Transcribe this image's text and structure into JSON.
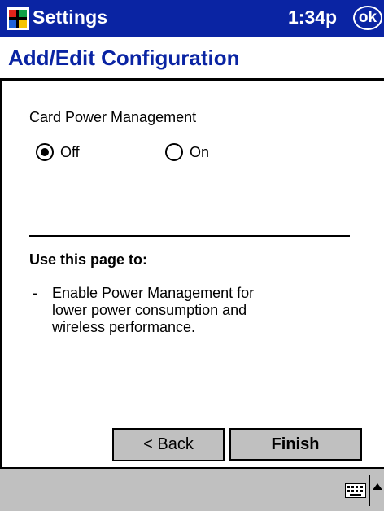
{
  "titlebar": {
    "app_title": "Settings",
    "time": "1:34p",
    "ok_label": "ok",
    "start_icon": "windows-flag-icon"
  },
  "page": {
    "title": "Add/Edit Configuration"
  },
  "power_management": {
    "group_label": "Card Power Management",
    "options": [
      {
        "label": "Off",
        "selected": true
      },
      {
        "label": "On",
        "selected": false
      }
    ]
  },
  "help": {
    "heading": "Use this page to:",
    "bullet": "-",
    "lines": [
      "Enable Power Management for",
      "lower power consumption and",
      "wireless performance."
    ]
  },
  "buttons": {
    "back_label": "< Back",
    "finish_label": "Finish"
  },
  "command_bar": {
    "keyboard_icon": "keyboard-icon",
    "sip_arrow_icon": "up-arrow-icon"
  },
  "colors": {
    "title_bar": "#0a24a3",
    "page_title": "#0a24a3",
    "button_face": "#c0c0c0",
    "command_bar": "#c0c0c0"
  }
}
